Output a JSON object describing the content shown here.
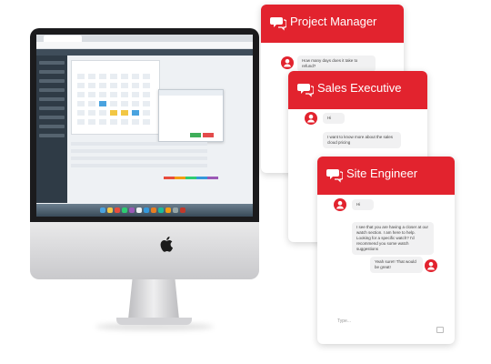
{
  "monitor": {
    "browser_tab": "",
    "bezel_color": "#1b1b1d",
    "apple_logo": "apple-logo"
  },
  "cards": [
    {
      "title": "Project Manager",
      "accent": "#e2232e",
      "icon": "chat-bubbles-icon",
      "messages": [
        {
          "from": "bot",
          "text": "How many days does it take to refund?"
        }
      ],
      "input_placeholder": ""
    },
    {
      "title": "Sales Executive",
      "accent": "#e2232e",
      "icon": "chat-bubbles-icon",
      "messages": [
        {
          "from": "bot",
          "text": "Hi"
        },
        {
          "from": "bot",
          "text": "I want to know more about the sales cloud pricing"
        }
      ],
      "input_placeholder": ""
    },
    {
      "title": "Site Engineer",
      "accent": "#e2232e",
      "icon": "chat-bubbles-icon",
      "messages": [
        {
          "from": "bot",
          "text": "Hi"
        },
        {
          "from": "bot",
          "text": "I see that you are having a closer at our watch section. I am here to help. Looking for a specific watch? I'd recommend you some watch suggestions"
        },
        {
          "from": "user",
          "text": "Yeah sure!! That would be great!"
        }
      ],
      "input_placeholder": "Type..."
    }
  ]
}
